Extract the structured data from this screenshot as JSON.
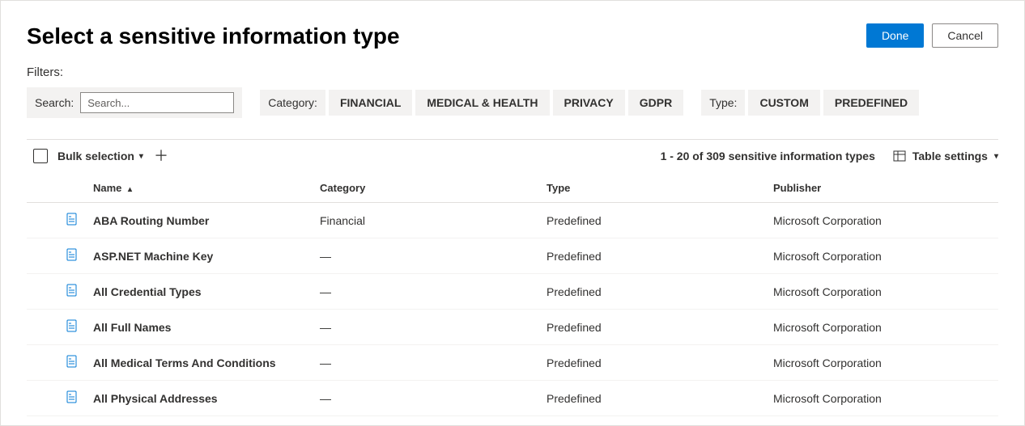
{
  "header": {
    "title": "Select a sensitive information type",
    "done_label": "Done",
    "cancel_label": "Cancel"
  },
  "filters": {
    "section_label": "Filters:",
    "search_label": "Search:",
    "search_placeholder": "Search...",
    "category_label": "Category:",
    "category_options": [
      "FINANCIAL",
      "MEDICAL & HEALTH",
      "PRIVACY",
      "GDPR"
    ],
    "type_label": "Type:",
    "type_options": [
      "CUSTOM",
      "PREDEFINED"
    ]
  },
  "toolbar": {
    "bulk_label": "Bulk selection",
    "count_text": "1 - 20 of 309 sensitive information types",
    "table_settings_label": "Table settings"
  },
  "columns": {
    "name": "Name",
    "category": "Category",
    "type": "Type",
    "publisher": "Publisher"
  },
  "rows": [
    {
      "name": "ABA Routing Number",
      "category": "Financial",
      "type": "Predefined",
      "publisher": "Microsoft Corporation"
    },
    {
      "name": "ASP.NET Machine Key",
      "category": "—",
      "type": "Predefined",
      "publisher": "Microsoft Corporation"
    },
    {
      "name": "All Credential Types",
      "category": "—",
      "type": "Predefined",
      "publisher": "Microsoft Corporation"
    },
    {
      "name": "All Full Names",
      "category": "—",
      "type": "Predefined",
      "publisher": "Microsoft Corporation"
    },
    {
      "name": "All Medical Terms And Conditions",
      "category": "—",
      "type": "Predefined",
      "publisher": "Microsoft Corporation"
    },
    {
      "name": "All Physical Addresses",
      "category": "—",
      "type": "Predefined",
      "publisher": "Microsoft Corporation"
    }
  ]
}
